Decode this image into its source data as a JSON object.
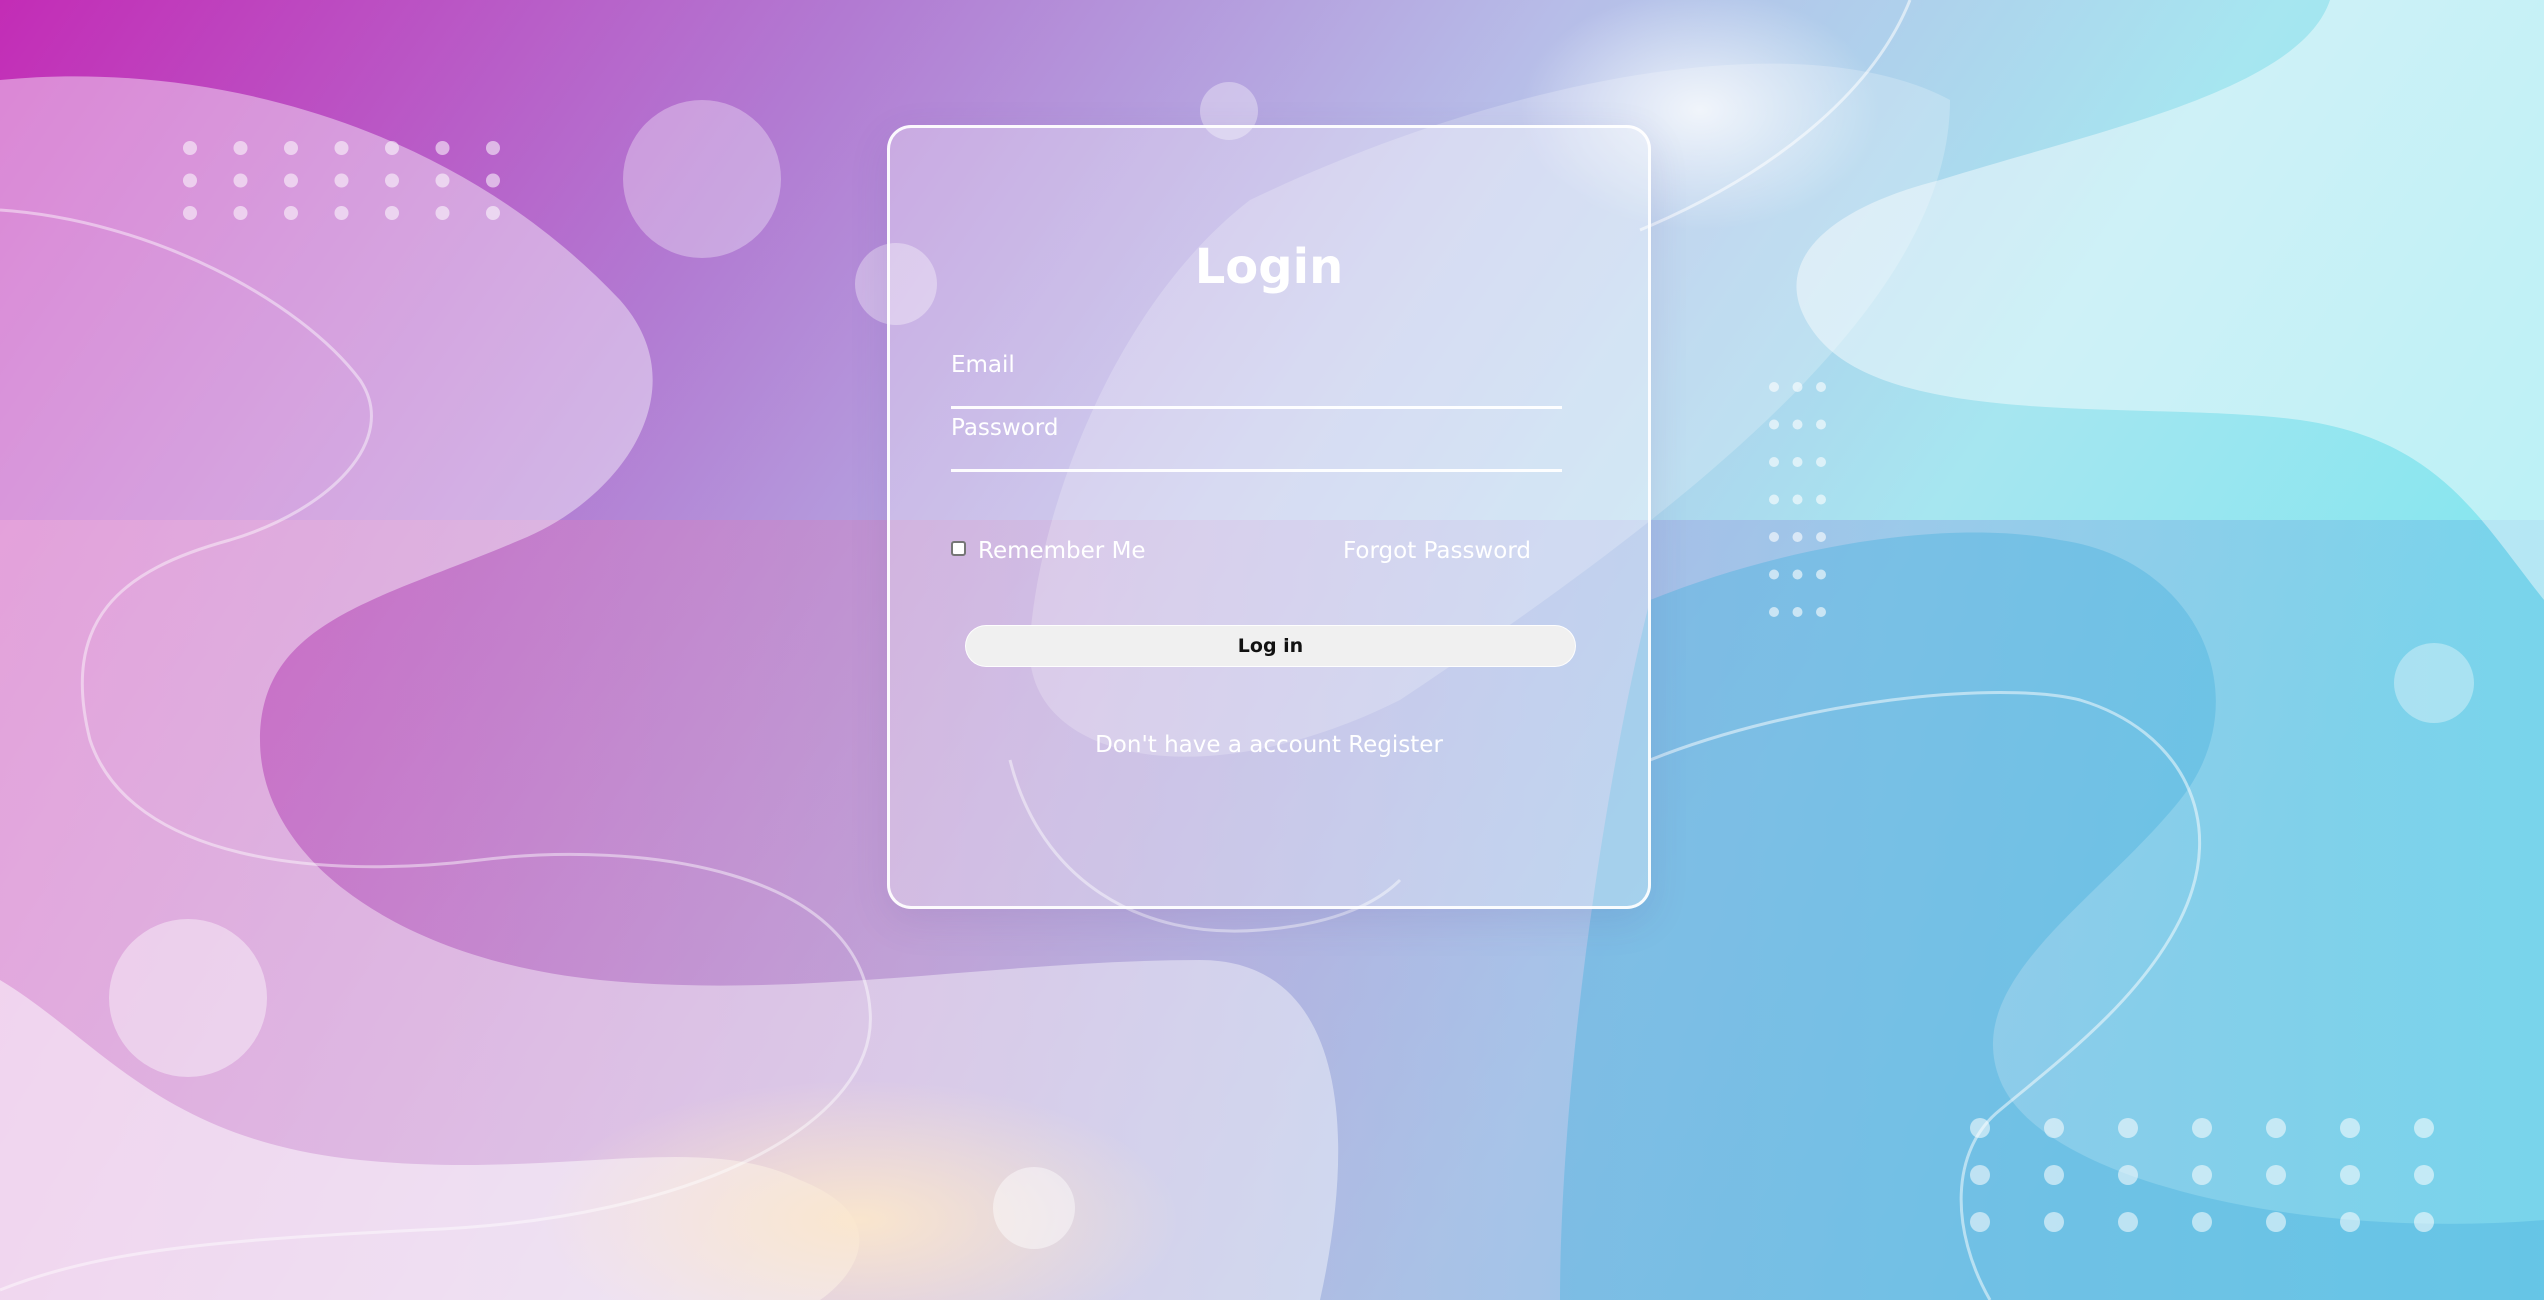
{
  "login": {
    "title": "Login",
    "email_label": "Email",
    "password_label": "Password",
    "remember_label": "Remember Me",
    "forgot_label": "Forgot Password",
    "submit_label": "Log in",
    "register_prompt": "Don't have a account",
    "register_link": "Register"
  },
  "colors": {
    "gradient_left": "#c130b8",
    "gradient_mid": "#b3a2e0",
    "gradient_right": "#8ae4ee",
    "text": "#ffffff",
    "button_bg": "#f0f0f0"
  }
}
